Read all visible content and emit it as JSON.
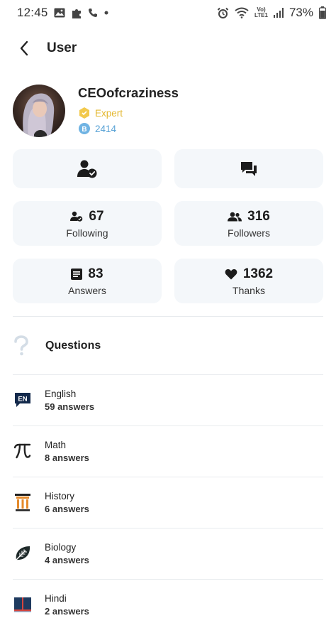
{
  "status_bar": {
    "time": "12:45",
    "battery": "73%",
    "network": "VoLTE1",
    "icons": [
      "image-icon",
      "puzzle-icon",
      "phone-icon",
      "dot-icon",
      "alarm-icon",
      "wifi-icon",
      "signal-icon",
      "battery-icon"
    ]
  },
  "header": {
    "title": "User",
    "back_icon": "chevron-left-icon"
  },
  "profile": {
    "username": "CEOofcraziness",
    "rank": "Expert",
    "points": "2414",
    "rank_color": "#e4b830",
    "points_color": "#5aa3d6"
  },
  "actions": {
    "follow_icon": "user-check-icon",
    "message_icon": "chat-icon"
  },
  "stats": {
    "following": {
      "value": "67",
      "label": "Following",
      "icon": "user-check-small-icon"
    },
    "followers": {
      "value": "316",
      "label": "Followers",
      "icon": "users-icon"
    },
    "answers": {
      "value": "83",
      "label": "Answers",
      "icon": "list-icon"
    },
    "thanks": {
      "value": "1362",
      "label": "Thanks",
      "icon": "heart-icon"
    }
  },
  "questions": {
    "title": "Questions",
    "icon": "question-mark-icon"
  },
  "subjects": [
    {
      "name": "English",
      "count": "59 answers",
      "icon": "english-icon",
      "icon_text": "EN"
    },
    {
      "name": "Math",
      "count": "8 answers",
      "icon": "math-pi-icon"
    },
    {
      "name": "History",
      "count": "6 answers",
      "icon": "history-column-icon"
    },
    {
      "name": "Biology",
      "count": "4 answers",
      "icon": "biology-leaf-icon"
    },
    {
      "name": "Hindi",
      "count": "2 answers",
      "icon": "hindi-book-icon"
    }
  ],
  "colors": {
    "card_bg": "#f4f7fa",
    "accent_dark": "#1c1c1c",
    "history_orange": "#e58a2b",
    "hindi_red": "#d6453d",
    "hindi_blue": "#1e3a5f"
  }
}
